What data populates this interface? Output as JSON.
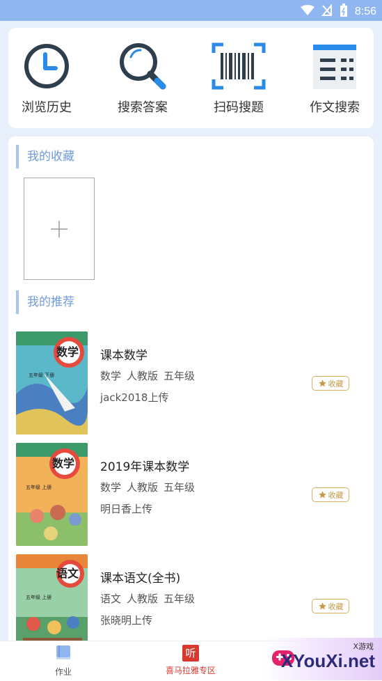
{
  "status_bar": {
    "time": "8:56"
  },
  "tools": [
    {
      "label": "浏览历史",
      "icon": "clock-icon"
    },
    {
      "label": "搜索答案",
      "icon": "search-icon"
    },
    {
      "label": "扫码搜题",
      "icon": "barcode-scan-icon"
    },
    {
      "label": "作文搜索",
      "icon": "document-list-icon"
    }
  ],
  "favorites": {
    "title": "我的收藏",
    "add_icon": "plus-icon"
  },
  "recommend": {
    "title": "我的推荐",
    "books": [
      {
        "title": "课本数学",
        "tags": [
          "数学",
          "人教版",
          "五年级"
        ],
        "uploader": "jack2018上传",
        "fav_label": "收藏",
        "cover_text": "数学",
        "cover_grade": "五年级 下册"
      },
      {
        "title": "2019年课本数学",
        "tags": [
          "数学",
          "人教版",
          "五年级"
        ],
        "uploader": "明日香上传",
        "fav_label": "收藏",
        "cover_text": "数学",
        "cover_grade": "五年级 上册"
      },
      {
        "title": "课本语文(全书)",
        "tags": [
          "语文",
          "人教版",
          "五年级"
        ],
        "uploader": "张晓明上传",
        "fav_label": "收藏",
        "cover_text": "语文",
        "cover_grade": "五年级 上册"
      }
    ]
  },
  "bottom_nav": [
    {
      "label": "作业",
      "icon": "book-icon",
      "color": "#555555"
    },
    {
      "label": "喜马拉雅专区",
      "icon": "listen-icon",
      "icon_char": "听",
      "color": "#d7392e"
    }
  ],
  "watermark": {
    "text": "XYouXi.net",
    "small": "X游戏"
  },
  "colors": {
    "accent": "#6f9cd8",
    "status_bar": "#8fb6f1",
    "fav": "#c79a48"
  }
}
